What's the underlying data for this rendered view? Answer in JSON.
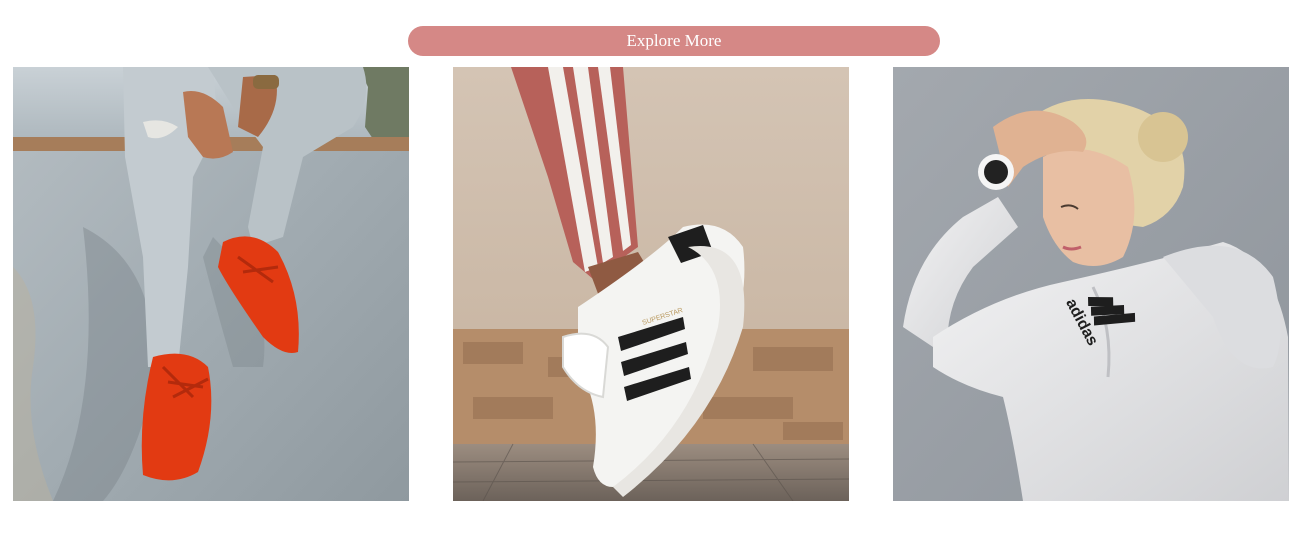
{
  "cta": {
    "label": "Explore More"
  },
  "colors": {
    "cta_background": "#d58886",
    "sneaker_red": "#e23a12",
    "concrete": "#a3adb4",
    "jeans": "#bfc7cc",
    "track_pants": "#b7615a",
    "wall_beige": "#cbb9a6",
    "brick": "#b58d6a",
    "backdrop_gray": "#9ea3aa",
    "hoodie": "#e9e9ea"
  },
  "gallery": {
    "images": [
      {
        "name": "red-sneakers-jeans-photo",
        "icon": "photo-icon"
      },
      {
        "name": "superstar-sneaker-photo",
        "icon": "photo-icon",
        "shoe_text": "SUPERSTAR"
      },
      {
        "name": "adidas-hoodie-photo",
        "icon": "photo-icon",
        "brand_text": "adidas"
      }
    ]
  }
}
